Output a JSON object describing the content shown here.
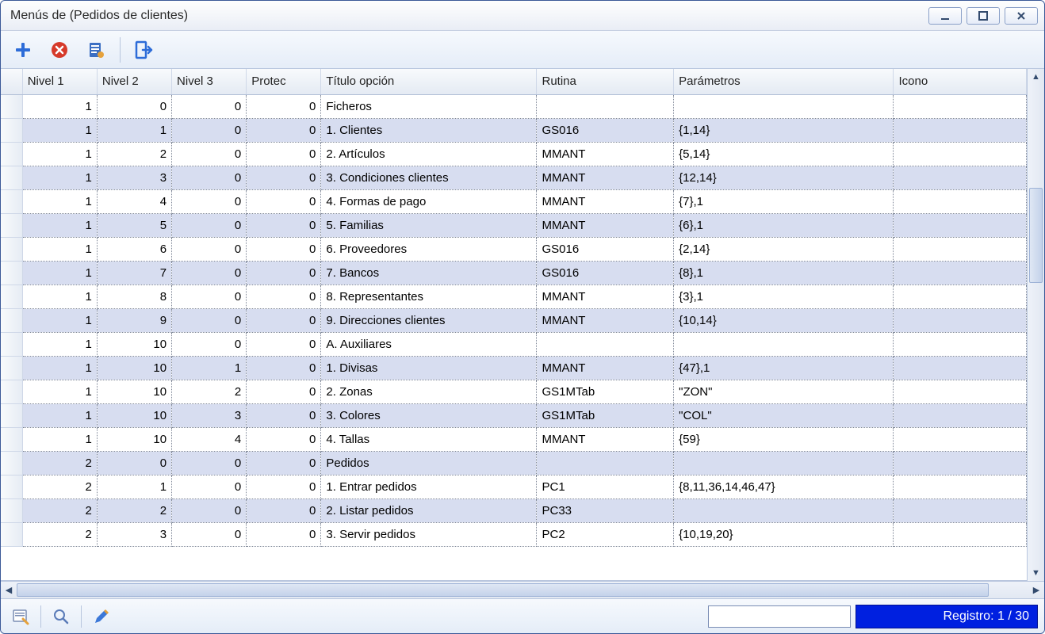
{
  "window": {
    "title": "Menús de (Pedidos de clientes)"
  },
  "toolbar": {
    "add": "add",
    "delete": "delete",
    "props": "properties",
    "exit": "exit"
  },
  "columns": {
    "rowsel": "",
    "nivel1": "Nivel 1",
    "nivel2": "Nivel 2",
    "nivel3": "Nivel 3",
    "protec": "Protec",
    "titulo": "Título opción",
    "rutina": "Rutina",
    "param": "Parámetros",
    "icono": "Icono"
  },
  "rows": [
    {
      "n1": "1",
      "n2": "0",
      "n3": "0",
      "pr": "0",
      "titulo": "Ficheros",
      "rutina": "",
      "param": "",
      "icono": ""
    },
    {
      "n1": "1",
      "n2": "1",
      "n3": "0",
      "pr": "0",
      "titulo": "1. Clientes",
      "rutina": "GS016",
      "param": "{1,14}",
      "icono": ""
    },
    {
      "n1": "1",
      "n2": "2",
      "n3": "0",
      "pr": "0",
      "titulo": "2. Artículos",
      "rutina": "MMANT",
      "param": "{5,14}",
      "icono": ""
    },
    {
      "n1": "1",
      "n2": "3",
      "n3": "0",
      "pr": "0",
      "titulo": "3. Condiciones clientes",
      "rutina": "MMANT",
      "param": "{12,14}",
      "icono": ""
    },
    {
      "n1": "1",
      "n2": "4",
      "n3": "0",
      "pr": "0",
      "titulo": "4. Formas de pago",
      "rutina": "MMANT",
      "param": "{7},1",
      "icono": ""
    },
    {
      "n1": "1",
      "n2": "5",
      "n3": "0",
      "pr": "0",
      "titulo": "5. Familias",
      "rutina": "MMANT",
      "param": "{6},1",
      "icono": ""
    },
    {
      "n1": "1",
      "n2": "6",
      "n3": "0",
      "pr": "0",
      "titulo": "6. Proveedores",
      "rutina": "GS016",
      "param": "{2,14}",
      "icono": ""
    },
    {
      "n1": "1",
      "n2": "7",
      "n3": "0",
      "pr": "0",
      "titulo": "7. Bancos",
      "rutina": "GS016",
      "param": "{8},1",
      "icono": ""
    },
    {
      "n1": "1",
      "n2": "8",
      "n3": "0",
      "pr": "0",
      "titulo": "8. Representantes",
      "rutina": "MMANT",
      "param": "{3},1",
      "icono": ""
    },
    {
      "n1": "1",
      "n2": "9",
      "n3": "0",
      "pr": "0",
      "titulo": "9. Direcciones clientes",
      "rutina": "MMANT",
      "param": "{10,14}",
      "icono": ""
    },
    {
      "n1": "1",
      "n2": "10",
      "n3": "0",
      "pr": "0",
      "titulo": "A. Auxiliares",
      "rutina": "",
      "param": "",
      "icono": ""
    },
    {
      "n1": "1",
      "n2": "10",
      "n3": "1",
      "pr": "0",
      "titulo": "1. Divisas",
      "rutina": "MMANT",
      "param": "{47},1",
      "icono": ""
    },
    {
      "n1": "1",
      "n2": "10",
      "n3": "2",
      "pr": "0",
      "titulo": "2. Zonas",
      "rutina": "GS1MTab",
      "param": "\"ZON\"",
      "icono": ""
    },
    {
      "n1": "1",
      "n2": "10",
      "n3": "3",
      "pr": "0",
      "titulo": "3. Colores",
      "rutina": "GS1MTab",
      "param": "\"COL\"",
      "icono": ""
    },
    {
      "n1": "1",
      "n2": "10",
      "n3": "4",
      "pr": "0",
      "titulo": "4. Tallas",
      "rutina": "MMANT",
      "param": "{59}",
      "icono": ""
    },
    {
      "n1": "2",
      "n2": "0",
      "n3": "0",
      "pr": "0",
      "titulo": "Pedidos",
      "rutina": "",
      "param": "",
      "icono": ""
    },
    {
      "n1": "2",
      "n2": "1",
      "n3": "0",
      "pr": "0",
      "titulo": "1. Entrar pedidos",
      "rutina": "PC1",
      "param": "{8,11,36,14,46,47}",
      "icono": ""
    },
    {
      "n1": "2",
      "n2": "2",
      "n3": "0",
      "pr": "0",
      "titulo": "2. Listar pedidos",
      "rutina": "PC33",
      "param": "",
      "icono": ""
    },
    {
      "n1": "2",
      "n2": "3",
      "n3": "0",
      "pr": "0",
      "titulo": "3. Servir pedidos",
      "rutina": "PC2",
      "param": "{10,19,20}",
      "icono": ""
    }
  ],
  "status": {
    "record_label": "Registro: 1 / 30",
    "search_value": ""
  }
}
